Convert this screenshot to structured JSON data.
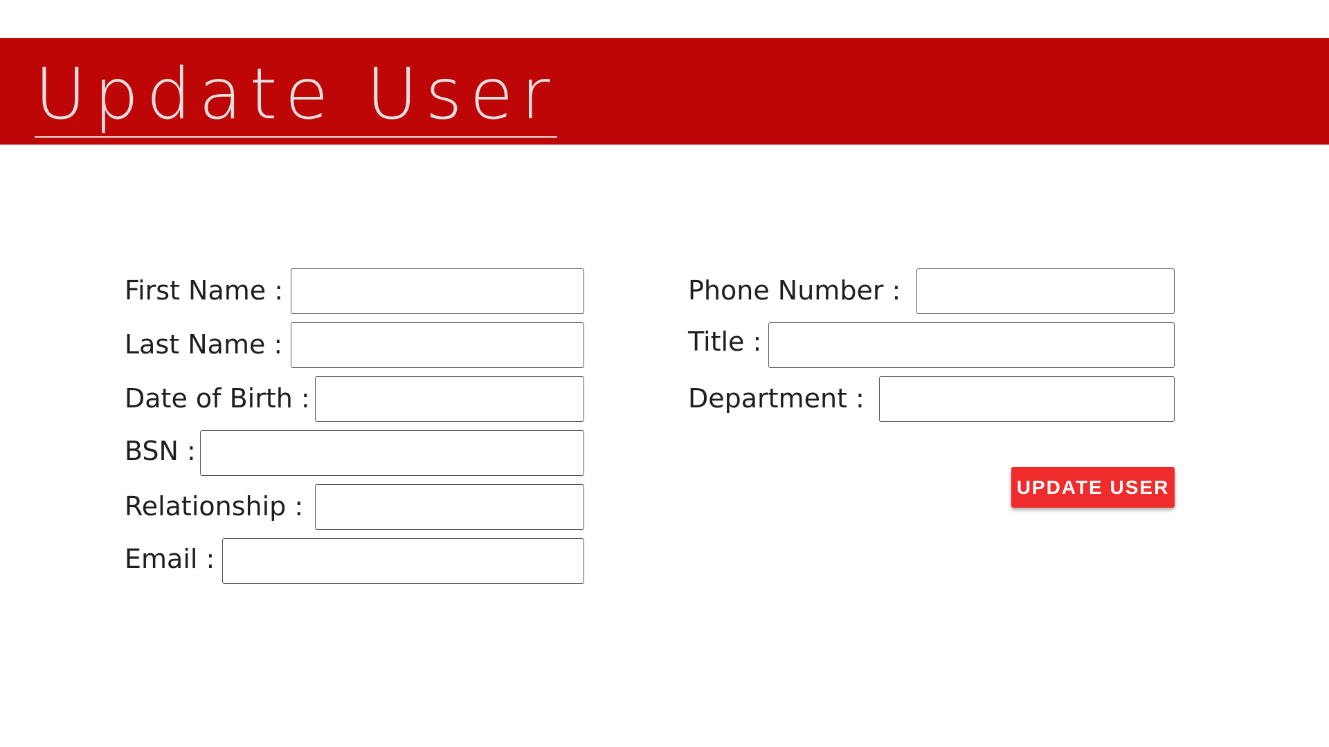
{
  "header": {
    "title": "Update User",
    "background_color": "#be0606",
    "title_color": "#e1e1e1"
  },
  "form": {
    "left_fields": [
      {
        "label": "First Name :",
        "value": "",
        "placeholder": ""
      },
      {
        "label": "Last Name :",
        "value": "",
        "placeholder": ""
      },
      {
        "label": "Date of Birth :",
        "value": "",
        "placeholder": ""
      },
      {
        "label": "BSN :",
        "value": "",
        "placeholder": ""
      },
      {
        "label": "Relationship :",
        "value": "",
        "placeholder": ""
      },
      {
        "label": "Email :",
        "value": "",
        "placeholder": ""
      }
    ],
    "right_fields": [
      {
        "label": "Phone Number :",
        "value": "",
        "placeholder": ""
      },
      {
        "label": "Title :",
        "value": "",
        "placeholder": ""
      },
      {
        "label": "Department :",
        "value": "",
        "placeholder": ""
      }
    ],
    "submit": {
      "label": "UPDATE USER",
      "color": "#f02b2b"
    }
  }
}
